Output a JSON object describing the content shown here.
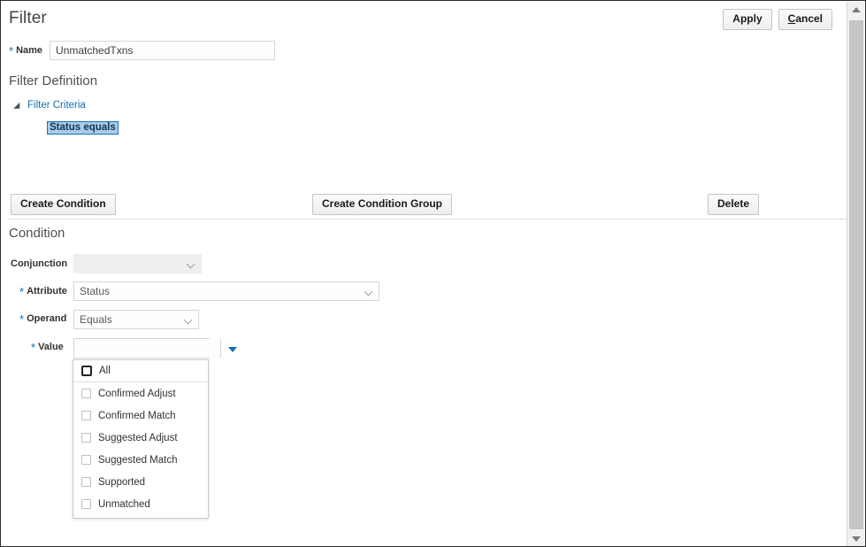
{
  "window": {
    "title": "Filter"
  },
  "header": {
    "title": "Filter",
    "apply_label": "Apply",
    "cancel_label_prefix": "C",
    "cancel_label_rest": "ancel",
    "cancel_label": "Cancel"
  },
  "name_field": {
    "label": "Name",
    "required_marker": "*",
    "value": "UnmatchedTxns",
    "placeholder": ""
  },
  "filter_definition": {
    "heading": "Filter Definition",
    "tree": {
      "root_label": "Filter Criteria",
      "expanded": true,
      "children": [
        {
          "label": "Status equals",
          "selected": true
        }
      ]
    }
  },
  "action_buttons": {
    "create_condition": "Create Condition",
    "create_condition_group": "Create Condition Group",
    "delete": "Delete"
  },
  "condition": {
    "heading": "Condition",
    "conjunction": {
      "label": "Conjunction",
      "required": false,
      "value": "",
      "disabled": true
    },
    "attribute": {
      "label": "Attribute",
      "required_marker": "*",
      "value": "Status"
    },
    "operand": {
      "label": "Operand",
      "required_marker": "*",
      "value": "Equals"
    },
    "value": {
      "label": "Value",
      "required_marker": "*",
      "value": "",
      "placeholder": ""
    }
  },
  "value_dropdown": {
    "open": true,
    "items": [
      {
        "label": "All",
        "checked": false,
        "focused": true,
        "separator_after": true
      },
      {
        "label": "Confirmed Adjust",
        "checked": false,
        "focused": false,
        "separator_after": false
      },
      {
        "label": "Confirmed Match",
        "checked": false,
        "focused": false,
        "separator_after": false
      },
      {
        "label": "Suggested Adjust",
        "checked": false,
        "focused": false,
        "separator_after": false
      },
      {
        "label": "Suggested Match",
        "checked": false,
        "focused": false,
        "separator_after": false
      },
      {
        "label": "Supported",
        "checked": false,
        "focused": false,
        "separator_after": false
      },
      {
        "label": "Unmatched",
        "checked": false,
        "focused": false,
        "separator_after": false
      }
    ]
  },
  "scrollbar": {
    "up_icon": "triangle-up-icon",
    "down_icon": "triangle-down-icon",
    "orientation": "vertical"
  },
  "colors": {
    "accent_blue": "#136fb0",
    "required_star": "#0572ce",
    "selection_bg": "#a9ccec",
    "selection_border": "#1b6eb0",
    "lov_arrow": "#1a6fb4",
    "page_border": "#2b2b2b"
  }
}
